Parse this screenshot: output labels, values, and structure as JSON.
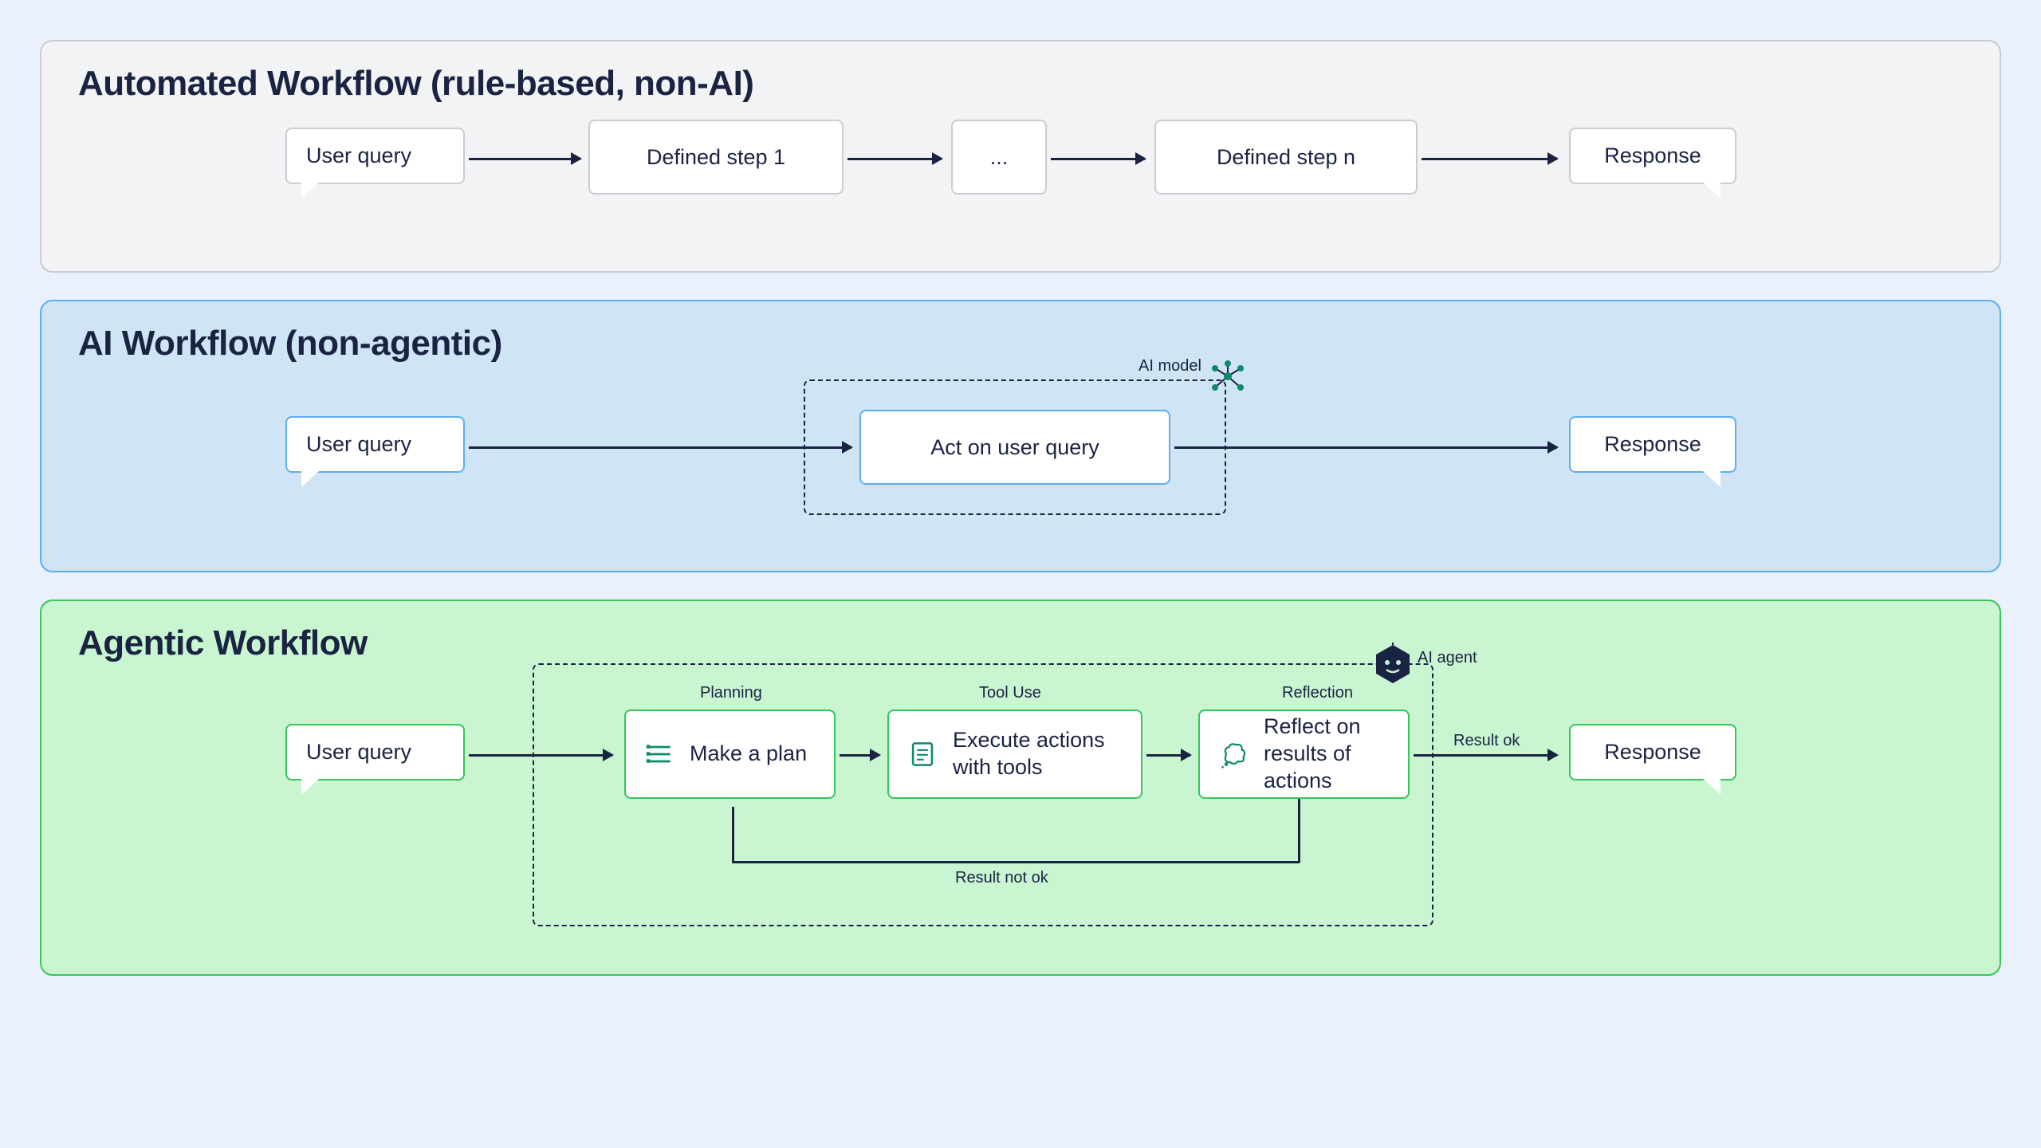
{
  "panels": {
    "automated": {
      "title": "Automated Workflow (rule-based, non-AI)",
      "user_query": "User query",
      "step1": "Defined step 1",
      "ellipsis": "...",
      "stepn": "Defined step n",
      "response": "Response"
    },
    "ai": {
      "title": "AI Workflow (non-agentic)",
      "user_query": "User query",
      "act": "Act on user query",
      "ai_model_label": "AI model",
      "response": "Response"
    },
    "agentic": {
      "title": "Agentic Workflow",
      "user_query": "User query",
      "plan": "Make a plan",
      "plan_label": "Planning",
      "exec": "Execute actions with tools",
      "exec_label": "Tool Use",
      "reflect": "Reflect on results of actions",
      "reflect_label": "Reflection",
      "agent_label": "AI agent",
      "result_ok": "Result ok",
      "result_not_ok": "Result not ok",
      "response": "Response"
    }
  },
  "colors": {
    "text": "#1a2342",
    "gray_border": "#c9cdd1",
    "blue_border": "#5dadf1",
    "green_border": "#34c759",
    "bg": "#eaf1fd"
  }
}
